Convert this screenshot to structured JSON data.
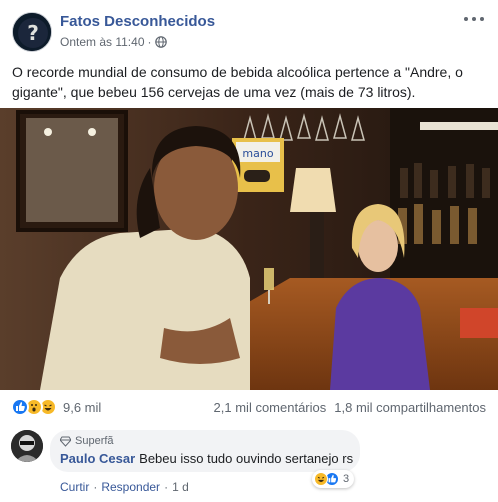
{
  "post": {
    "page_name": "Fatos Desconhecidos",
    "timestamp": "Ontem às 11:40",
    "separator": "·",
    "privacy_icon": "globe-icon",
    "text": "O recorde mundial de consumo de bebida alcoólica pertence a \"Andre, o gigante\", que bebeu 156 cervejas de uma vez (mais de 73 litros)."
  },
  "photo": {
    "description_icon": "bar-scene-photo",
    "sign_text": "mano"
  },
  "stats": {
    "reaction_icons": [
      "like-icon",
      "wow-icon",
      "haha-icon"
    ],
    "reaction_count": "9,6 mil",
    "comments": "2,1 mil comentários",
    "shares": "1,8 mil compartilhamentos"
  },
  "comment": {
    "badge": "Superfã",
    "author": "Paulo Cesar",
    "text": "Bebeu isso tudo ouvindo sertanejo rs",
    "reaction_icons": [
      "haha-icon",
      "like-icon"
    ],
    "reaction_count": "3",
    "actions": {
      "like": "Curtir",
      "reply": "Responder",
      "time": "1 d",
      "sep": "·"
    }
  },
  "colors": {
    "link": "#385898",
    "muted": "#606770",
    "like_blue": "#1877f2",
    "haha_yellow": "#f7b928",
    "bubble_bg": "#f2f3f5"
  }
}
